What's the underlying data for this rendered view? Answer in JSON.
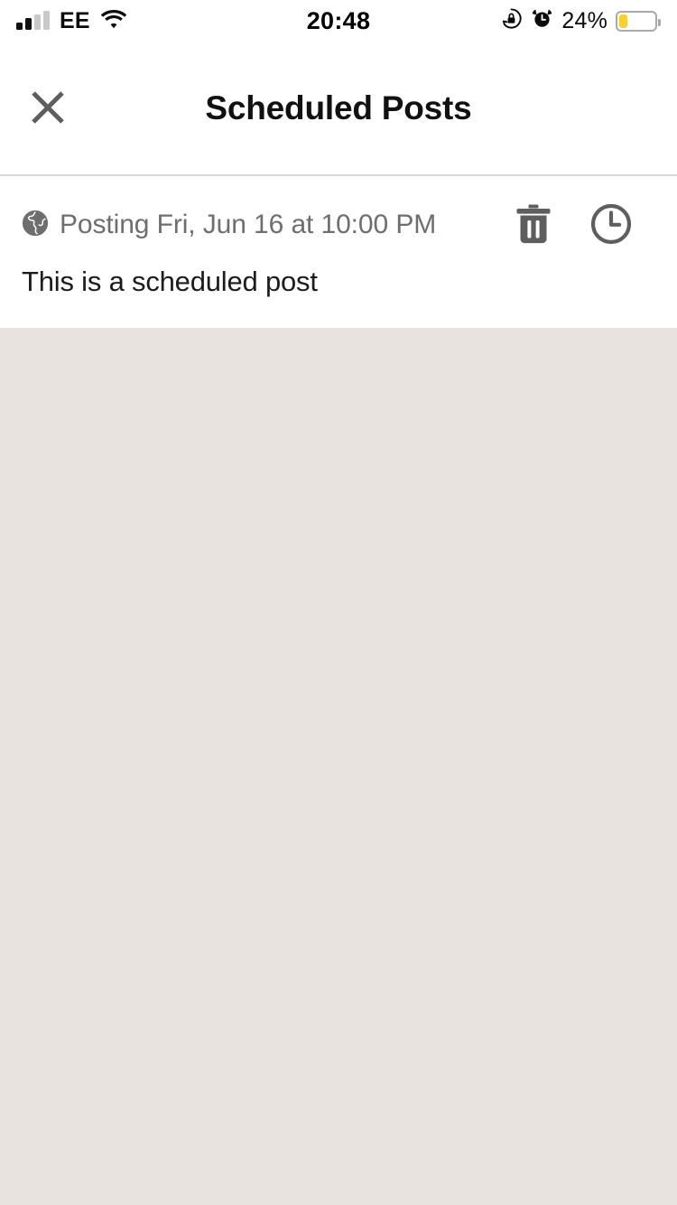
{
  "status_bar": {
    "carrier": "EE",
    "signal_icon": "signal-bars-icon",
    "signal_bars_filled": 2,
    "signal_bars_total": 4,
    "wifi_icon": "wifi-icon",
    "time": "20:48",
    "rotation_lock_icon": "rotation-lock-icon",
    "alarm_icon": "alarm-clock-icon",
    "battery_percent_label": "24%",
    "battery_level": 24,
    "battery_color": "#F9CE34",
    "battery_icon": "battery-icon"
  },
  "header": {
    "close_icon": "close-icon",
    "title": "Scheduled Posts"
  },
  "post": {
    "privacy_icon": "globe-icon",
    "schedule_text": "Posting Fri, Jun 16 at 10:00 PM",
    "body": "This is a scheduled post",
    "delete_icon": "trash-icon",
    "reschedule_icon": "clock-icon"
  },
  "theme": {
    "background": "#E8E3DE",
    "card": "#FFFFFF",
    "title_color": "#111111",
    "muted_text": "#6E6E6E",
    "divider": "#D8D8D8"
  }
}
